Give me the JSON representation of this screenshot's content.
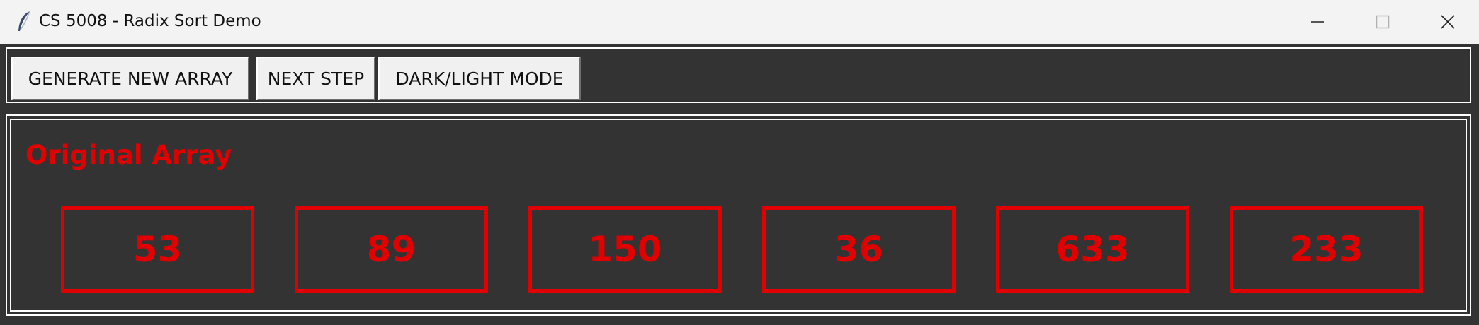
{
  "window": {
    "title": "CS 5008 - Radix Sort Demo",
    "icon": "feather-icon",
    "controls": [
      "minimize-icon",
      "maximize-icon",
      "close-icon"
    ]
  },
  "toolbar": {
    "generate_label": "GENERATE NEW ARRAY",
    "next_label": "NEXT STEP",
    "mode_label": "DARK/LIGHT MODE"
  },
  "panel": {
    "title": "Original Array",
    "values": [
      "53",
      "89",
      "150",
      "36",
      "633",
      "233"
    ]
  },
  "colors": {
    "background": "#333333",
    "accent": "#e00000",
    "button": "#f0f0f0",
    "titlebar": "#f3f3f3"
  }
}
